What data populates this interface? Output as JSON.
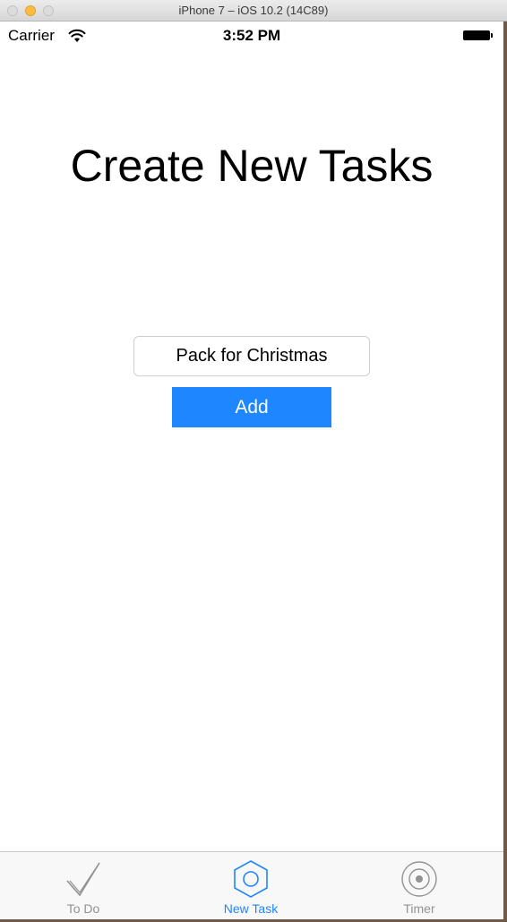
{
  "window": {
    "title": "iPhone 7 – iOS 10.2 (14C89)"
  },
  "status_bar": {
    "carrier": "Carrier",
    "time": "3:52 PM",
    "wifi_icon": "wifi-icon",
    "battery_icon": "battery-icon"
  },
  "main": {
    "title": "Create New Tasks",
    "task_input": {
      "value": "Pack for Christmas",
      "placeholder": ""
    },
    "add_button_label": "Add",
    "accent_color": "#1e86ff"
  },
  "tab_bar": {
    "selected": "New Task",
    "items": [
      {
        "label": "To Do",
        "icon": "checkmark-icon",
        "active": false
      },
      {
        "label": "New Task",
        "icon": "hexagon-icon",
        "active": true
      },
      {
        "label": "Timer",
        "icon": "target-icon",
        "active": false
      }
    ]
  }
}
